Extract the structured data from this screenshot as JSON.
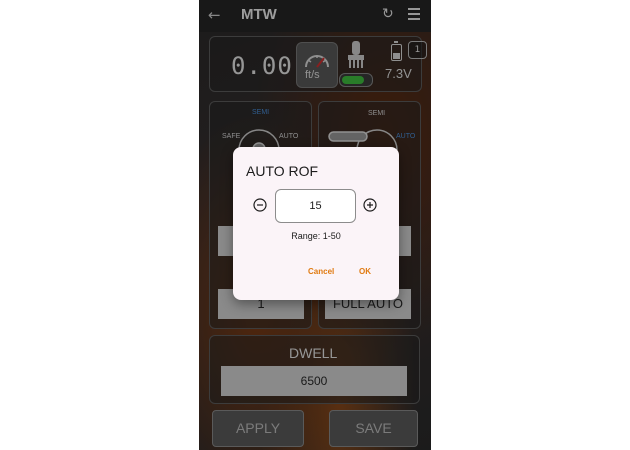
{
  "app": {
    "title": "MTW"
  },
  "status": {
    "speed": "0.00",
    "speed_unit": "ft/s",
    "voltage": "7.3V",
    "badge_count": "1",
    "toggle_on": true
  },
  "mode_left": {
    "labels": {
      "safe": "SAFE",
      "semi": "SEMI",
      "auto": "AUTO"
    },
    "active": "semi",
    "value": "1"
  },
  "mode_right": {
    "labels": {
      "semi": "SEMI",
      "auto": "AUTO"
    },
    "active": "auto",
    "value": "FULL AUTO"
  },
  "dwell": {
    "title": "DWELL",
    "value": "6500"
  },
  "actions": {
    "apply": "APPLY",
    "save": "SAVE"
  },
  "dialog": {
    "title": "AUTO ROF",
    "value": "15",
    "range": "Range: 1-50",
    "cancel": "Cancel",
    "ok": "OK"
  },
  "colors": {
    "accent": "#e07a10",
    "active_mode": "#4a8fdb",
    "toggle_on": "#3fbf3f"
  }
}
